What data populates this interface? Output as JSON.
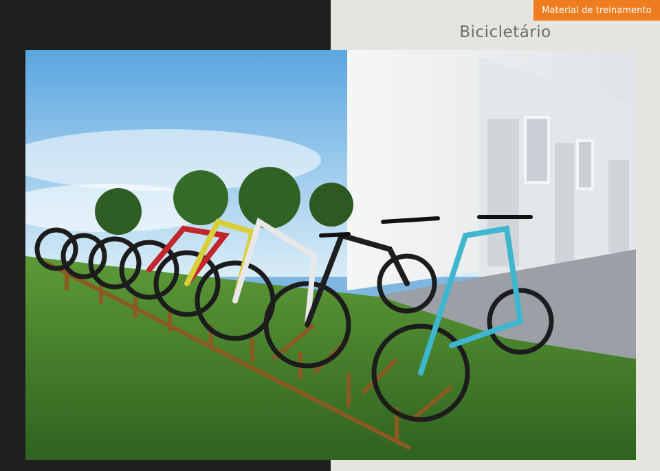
{
  "header": {
    "badge_label": "Material de treinamento",
    "title": "Bicicletário"
  },
  "photo": {
    "subject": "bike-rack-photo",
    "colors": {
      "sky": "#6fb3e6",
      "grass": "#3f7a2a",
      "wall": "#eef0f1",
      "rack": "#8a5a22",
      "accent_bike": "#3fb6cf"
    }
  }
}
